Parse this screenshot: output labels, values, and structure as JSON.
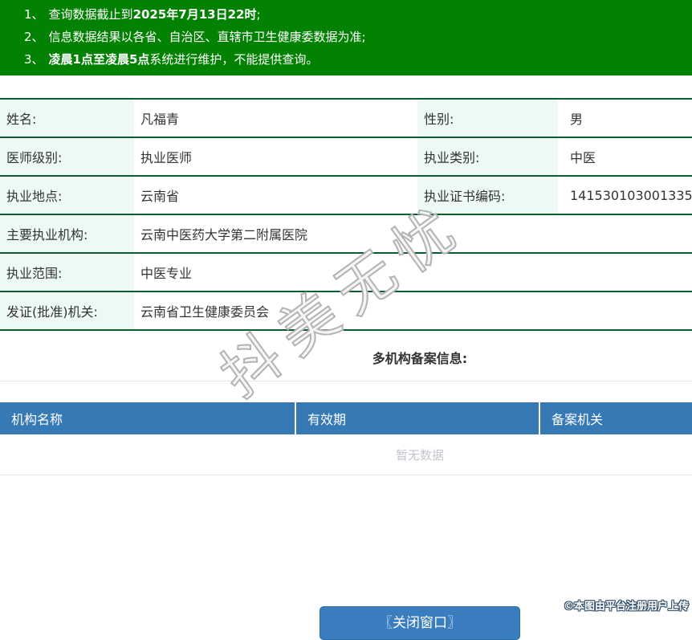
{
  "notices": {
    "items": [
      {
        "num": "1、",
        "pre": "查询数据截止到",
        "bold": "2025年7月13日22时",
        "post": ";"
      },
      {
        "num": "2、",
        "pre": "信息数据结果以各省、自治区、直辖市卫生健康委数据为准;",
        "bold": "",
        "post": ""
      },
      {
        "num": "3、",
        "pre": "",
        "bold": "凌晨1点至凌晨5点",
        "post": "系统进行维护，不能提供查询。"
      }
    ]
  },
  "info": {
    "name_label": "姓名:",
    "name_value": "凡福青",
    "gender_label": "性别:",
    "gender_value": "男",
    "level_label": "医师级别:",
    "level_value": "执业医师",
    "category_label": "执业类别:",
    "category_value": "中医",
    "location_label": "执业地点:",
    "location_value": "云南省",
    "cert_label": "执业证书编码:",
    "cert_value": "141530103001335",
    "org_label": "主要执业机构:",
    "org_value": "云南中医药大学第二附属医院",
    "scope_label": "执业范围:",
    "scope_value": "中医专业",
    "authority_label": "发证(批准)机关:",
    "authority_value": "云南省卫生健康委员会"
  },
  "multi_org": {
    "title": "多机构备案信息:",
    "columns": [
      "机构名称",
      "有效期",
      "备案机关"
    ],
    "empty_text": "暂无数据"
  },
  "footer": {
    "close_button": "〖关闭窗口〗"
  },
  "watermarks": {
    "diagonal": "抖美无忧",
    "photo_credit": "©本图由平台注册用户上传"
  },
  "colors": {
    "notice_green": "#028102",
    "table_border_green": "#0c5c32",
    "label_bg_mint": "#edfaf3",
    "grid_header_blue": "#3579b5",
    "button_blue": "#3a7ec0"
  }
}
